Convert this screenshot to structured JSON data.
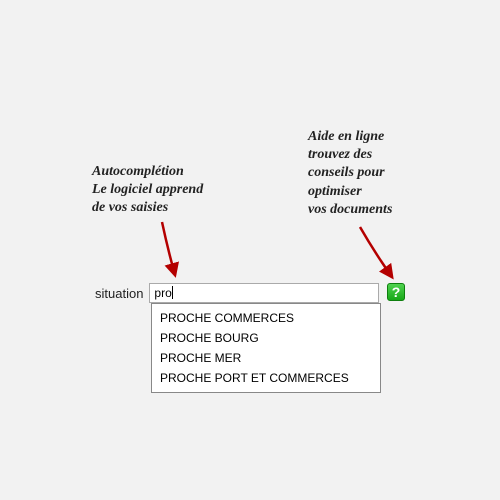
{
  "annotations": {
    "left": "Autocomplétion\nLe logiciel apprend\nde vos saisies",
    "right": "Aide en ligne\ntrouvez des\nconseils pour\noptimiser\nvos documents"
  },
  "field": {
    "label": "situation",
    "value": "pro"
  },
  "help": {
    "symbol": "?"
  },
  "suggestions": [
    "PROCHE COMMERCES",
    "PROCHE BOURG",
    "PROCHE MER",
    "PROCHE PORT ET COMMERCES"
  ]
}
